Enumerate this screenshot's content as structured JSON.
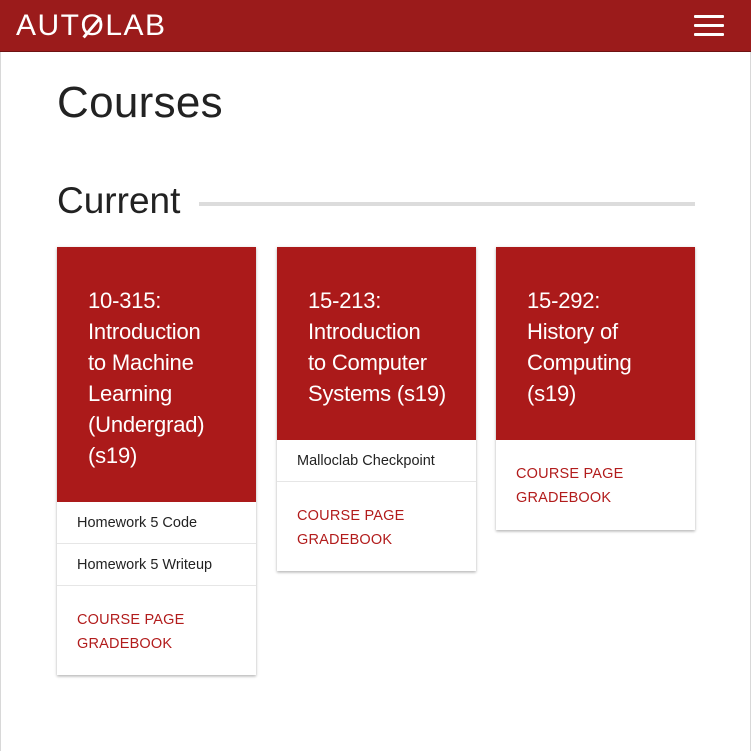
{
  "navbar": {
    "brand_pre": "AUT",
    "brand_o": "O",
    "brand_post": "LAB",
    "menu_icon": "hamburger-menu-icon"
  },
  "page": {
    "title": "Courses",
    "section_current": "Current"
  },
  "courses": [
    {
      "title_lines": [
        "10-315:",
        "Introduction",
        "to Machine",
        "Learning",
        "(Undergrad)",
        "(s19)"
      ],
      "assessments": [
        "Homework 5 Code",
        "Homework 5 Writeup"
      ],
      "course_page_label": "COURSE PAGE",
      "gradebook_label": "GRADEBOOK"
    },
    {
      "title_lines": [
        "15-213:",
        "Introduction",
        "to Computer",
        "Systems (s19)"
      ],
      "assessments": [
        "Malloclab Checkpoint"
      ],
      "course_page_label": "COURSE PAGE",
      "gradebook_label": "GRADEBOOK"
    },
    {
      "title_lines": [
        "15-292:",
        "History of",
        "Computing",
        "(s19)"
      ],
      "assessments": [],
      "course_page_label": "COURSE PAGE",
      "gradebook_label": "GRADEBOOK"
    }
  ],
  "colors": {
    "navbar": "#9b1b1b",
    "card_header": "#ab1a1a",
    "link": "#b21c1c"
  }
}
